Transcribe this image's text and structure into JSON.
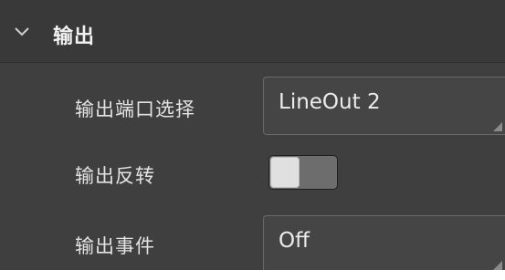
{
  "section": {
    "title": "输出",
    "expanded_icon": "chevron-down-icon"
  },
  "rows": {
    "port_select": {
      "label": "输出端口选择",
      "value": "LineOut 2"
    },
    "invert": {
      "label": "输出反转",
      "toggle_on": false
    },
    "event": {
      "label": "输出事件",
      "value": "Off"
    }
  },
  "colors": {
    "panel_bg": "#3f3f3f",
    "header_bg": "#393939",
    "field_bg": "#454545",
    "text": "#e3e3e3"
  }
}
